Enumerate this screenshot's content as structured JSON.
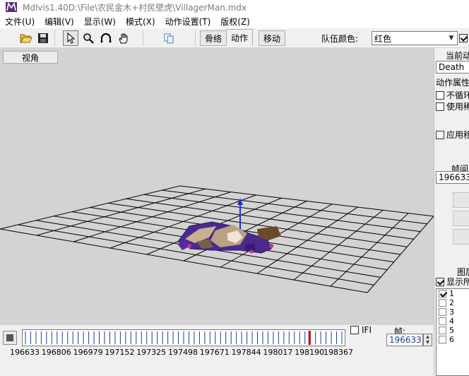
{
  "window": {
    "title": "Mdlvis1.40D:\\File\\农民金木+村民壁虎\\VillagerMan.mdx"
  },
  "menu": [
    "文件(U)",
    "编辑(V)",
    "显示(W)",
    "模式(X)",
    "动作设置(T)",
    "版权(Z)"
  ],
  "tabs": [
    "骨络",
    "动作",
    "移动"
  ],
  "active_tab": "动作",
  "team": {
    "label": "队伍颜色:",
    "value": "红色"
  },
  "viewport": {
    "view_button": "视角",
    "background": "#d3d3d3",
    "grid_color": "#000000"
  },
  "right_panel": {
    "title": "当前动",
    "animation": "Death",
    "props_label": "动作属性",
    "checks": [
      {
        "label": "不循环",
        "checked": false
      },
      {
        "label": "使用稀",
        "checked": false
      },
      {
        "label": "应用移",
        "checked": false
      }
    ],
    "frame_label": "帧间",
    "frame_value": "196633",
    "geo_label": "图层",
    "show_all": {
      "label": "显示所",
      "checked": true
    },
    "layers": [
      {
        "label": "1",
        "checked": true
      },
      {
        "label": "2",
        "checked": false
      },
      {
        "label": "3",
        "checked": false
      },
      {
        "label": "4",
        "checked": false
      },
      {
        "label": "5",
        "checked": false
      },
      {
        "label": "6",
        "checked": false
      }
    ]
  },
  "timeline": {
    "labels": [
      "196633",
      "196806",
      "196979",
      "197152",
      "197325",
      "197498",
      "197671",
      "197844",
      "198017",
      "198190",
      "198367"
    ],
    "start": 196633,
    "end": 198367,
    "marker": 198190,
    "marker_color": "#c00000"
  },
  "ifi": {
    "label": "IFI",
    "checked": false
  },
  "frame": {
    "label": "帧:",
    "value": "196633"
  }
}
